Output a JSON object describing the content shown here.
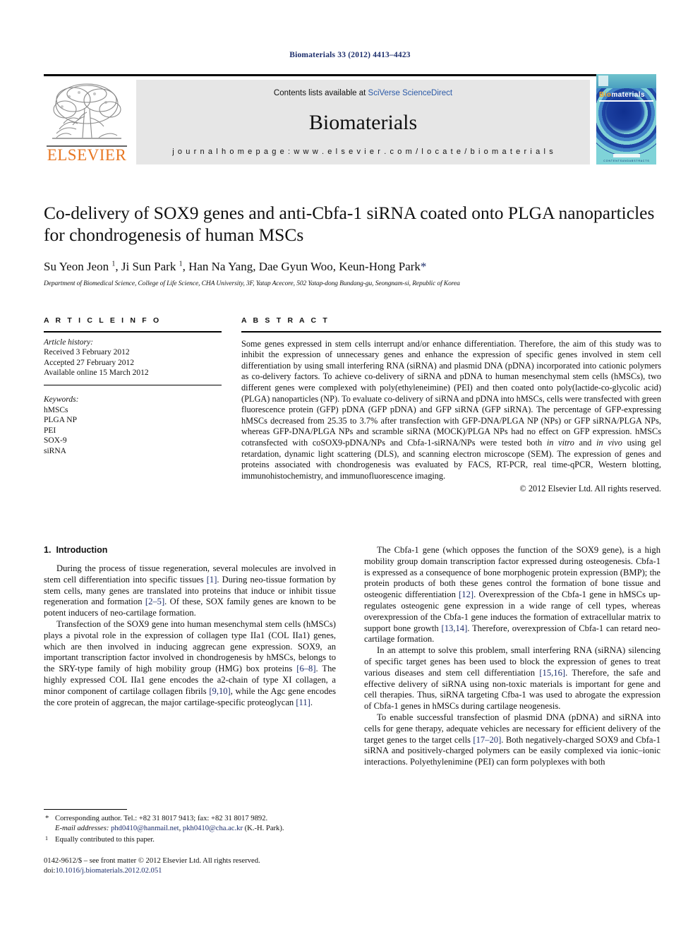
{
  "running_head": "Biomaterials 33 (2012) 4413–4423",
  "masthead": {
    "contents_prefix": "Contents lists available at ",
    "contents_link": "SciVerse ScienceDirect",
    "journal_title": "Biomaterials",
    "homepage": "j o u r n a l   h o m e p a g e :   w w w . e l s e v i e r . c o m / l o c a t e / b i o m a t e r i a l s",
    "publisher_logo_text": "ELSEVIER",
    "cover_word_b": "Bio",
    "cover_word_rest": "materials",
    "cover_footer": "C O N T E N T S   A N D   A B S T R A C T S"
  },
  "article": {
    "title": "Co-delivery of SOX9 genes and anti-Cbfa-1 siRNA coated onto PLGA nanoparticles for chondrogenesis of human MSCs",
    "authors_html": "Su Yeon Jeon <sup>1</sup>, Ji Sun Park <sup>1</sup>, Han Na Yang, Dae Gyun Woo, Keun-Hong Park<span class=\"star\">*</span>",
    "affiliation": "Department of Biomedical Science, College of Life Science, CHA University, 3F, Yatap Acecore, 502 Yatap-dong Bundang-gu, Seongnam-si, Republic of Korea"
  },
  "article_info": {
    "heading": "A R T I C L E   I N F O",
    "history_label": "Article history:",
    "history": [
      "Received 3 February 2012",
      "Accepted 27 February 2012",
      "Available online 15 March 2012"
    ],
    "keywords_label": "Keywords:",
    "keywords": [
      "hMSCs",
      "PLGA NP",
      "PEI",
      "SOX-9",
      "siRNA"
    ]
  },
  "abstract": {
    "heading": "A B S T R A C T",
    "text_html": "Some genes expressed in stem cells interrupt and/or enhance differentiation. Therefore, the aim of this study was to inhibit the expression of unnecessary genes and enhance the expression of specific genes involved in stem cell differentiation by using small interfering RNA (siRNA) and plasmid DNA (pDNA) incorporated into cationic polymers as co-delivery factors. To achieve co-delivery of siRNA and pDNA to human mesenchymal stem cells (hMSCs), two different genes were complexed with poly(ethyleneimine) (PEI) and then coated onto poly(lactide-co-glycolic acid) (PLGA) nanoparticles (NP). To evaluate co-delivery of siRNA and pDNA into hMSCs, cells were transfected with green fluorescence protein (GFP) pDNA (GFP pDNA) and GFP siRNA (GFP siRNA). The percentage of GFP-expressing hMSCs decreased from 25.35 to 3.7% after transfection with GFP-DNA/PLGA NP (NPs) or GFP siRNA/PLGA NPs, whereas GFP-DNA/PLGA NPs and scramble siRNA (MOCK)/PLGA NPs had no effect on GFP expression. hMSCs cotransfected with coSOX9-pDNA/NPs and Cbfa-1-siRNA/NPs were tested both <em>in vitro</em> and <em>in vivo</em> using gel retardation, dynamic light scattering (DLS), and scanning electron microscope (SEM). The expression of genes and proteins associated with chondrogenesis was evaluated by FACS, RT-PCR, real time-qPCR, Western blotting, immunohistochemistry, and immunofluorescence imaging.",
    "copyright": "© 2012 Elsevier Ltd. All rights reserved."
  },
  "sections": {
    "intro_number": "1.",
    "intro_title": "Introduction",
    "left_paragraphs_html": [
      "During the process of tissue regeneration, several molecules are involved in stem cell differentiation into specific tissues <span class=\"ref\">[1]</span>. During neo-tissue formation by stem cells, many genes are translated into proteins that induce or inhibit tissue regeneration and formation <span class=\"ref\">[2–5]</span>. Of these, SOX family genes are known to be potent inducers of neo-cartilage formation.",
      "Transfection of the SOX9 gene into human mesenchymal stem cells (hMSCs) plays a pivotal role in the expression of collagen type IIa1 (COL IIa1) genes, which are then involved in inducing aggrecan gene expression. SOX9, an important transcription factor involved in chondrogenesis by hMSCs, belongs to the SRY-type family of high mobility group (HMG) box proteins <span class=\"ref\">[6–8]</span>. The highly expressed COL IIa1 gene encodes the a2-chain of type XI collagen, a minor component of cartilage collagen fibrils <span class=\"ref\">[9,10]</span>, while the Agc gene encodes the core protein of aggrecan, the major cartilage-specific proteoglycan <span class=\"ref\">[11]</span>."
    ],
    "right_paragraphs_html": [
      "The Cbfa-1 gene (which opposes the function of the SOX9 gene), is a high mobility group domain transcription factor expressed during osteogenesis. Cbfa-1 is expressed as a consequence of bone morphogenic protein expression (BMP); the protein products of both these genes control the formation of bone tissue and osteogenic differentiation <span class=\"ref\">[12]</span>. Overexpression of the Cbfa-1 gene in hMSCs up-regulates osteogenic gene expression in a wide range of cell types, whereas overexpression of the Cbfa-1 gene induces the formation of extracellular matrix to support bone growth <span class=\"ref\">[13,14]</span>. Therefore, overexpression of Cbfa-1 can retard neo-cartilage formation.",
      "In an attempt to solve this problem, small interfering RNA (siRNA) silencing of specific target genes has been used to block the expression of genes to treat various diseases and stem cell differentiation <span class=\"ref\">[15,16]</span>. Therefore, the safe and effective delivery of siRNA using non-toxic materials is important for gene and cell therapies. Thus, siRNA targeting Cfba-1 was used to abrogate the expression of Cbfa-1 genes in hMSCs during cartilage neogenesis.",
      "To enable successful transfection of plasmid DNA (pDNA) and siRNA into cells for gene therapy, adequate vehicles are necessary for efficient delivery of the target genes to the target cells <span class=\"ref\">[17–20]</span>. Both negatively-charged SOX9 and Cbfa-1 siRNA and positively-charged polymers can be easily complexed via ionic–ionic interactions. Polyethylenimine (PEI) can form polyplexes with both"
    ]
  },
  "footnotes": {
    "corresponding_html": "Corresponding author. Tel.: +82 31 8017 9413; fax: +82 31 8017 9892.",
    "email_label": "E-mail addresses:",
    "email_html": "<span class=\"mail\">phd0410@hanmail.net</span>, <span class=\"mail\">pkh0410@cha.ac.kr</span> (K.-H. Park).",
    "equal_contrib": "Equally contributed to this paper."
  },
  "imprint": {
    "line1": "0142-9612/$ – see front matter © 2012 Elsevier Ltd. All rights reserved.",
    "doi_label": "doi:",
    "doi_value": "10.1016/j.biomaterials.2012.02.051"
  }
}
